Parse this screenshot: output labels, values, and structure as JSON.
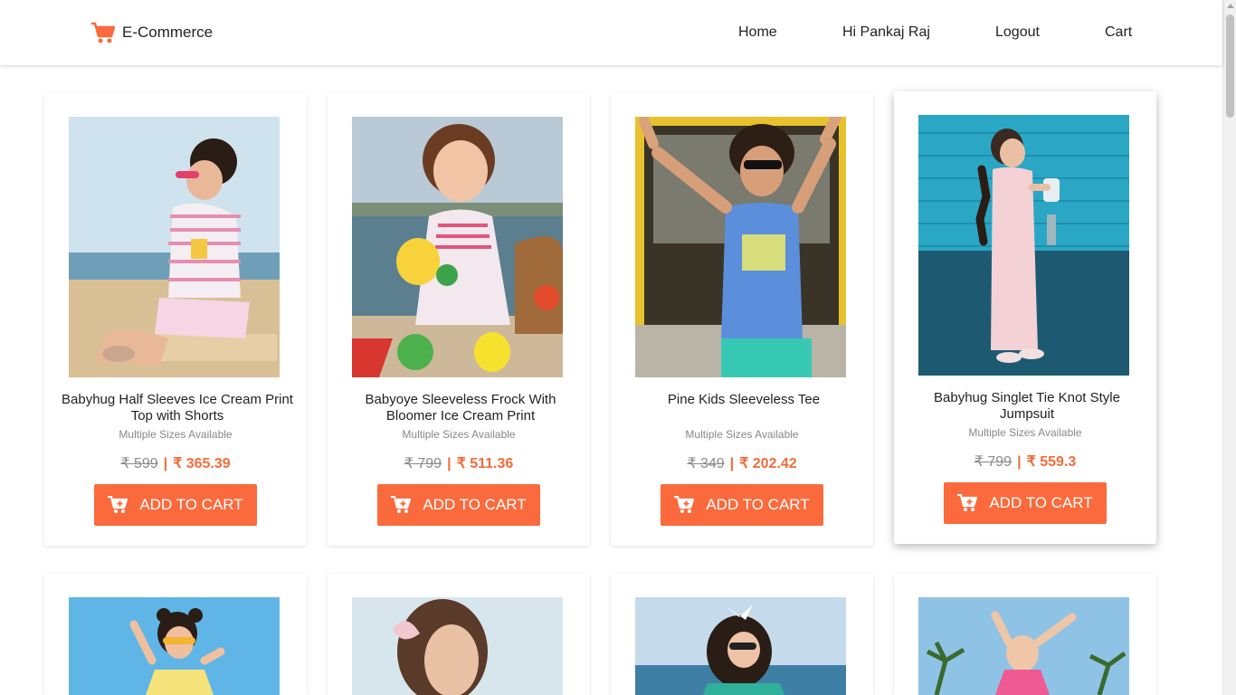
{
  "nav": {
    "brand": "E-Commerce",
    "links": [
      "Home",
      "Hi Pankaj Raj",
      "Logout",
      "Cart"
    ],
    "brand_icon": "shopping-cart-icon",
    "accent": "#fb6a3c"
  },
  "products": [
    {
      "title": "Babyhug Half Sleeves Ice Cream Print Top with Shorts",
      "sizes": "Multiple Sizes Available",
      "mrp": "₹ 599",
      "price": "₹ 365.39",
      "button": "ADD TO CART"
    },
    {
      "title": "Babyoye Sleeveless Frock With Bloomer Ice Cream Print",
      "sizes": "Multiple Sizes Available",
      "mrp": "₹ 799",
      "price": "₹ 511.36",
      "button": "ADD TO CART"
    },
    {
      "title": "Pine Kids Sleeveless Tee",
      "sizes": "Multiple Sizes Available",
      "mrp": "₹ 349",
      "price": "₹ 202.42",
      "button": "ADD TO CART"
    },
    {
      "title": "Babyhug Singlet Tie Knot Style Jumpsuit",
      "sizes": "Multiple Sizes Available",
      "mrp": "₹ 799",
      "price": "₹ 559.3",
      "button": "ADD TO CART"
    }
  ],
  "colors": {
    "sale_price": "#f26b3a",
    "mrp": "#8a8a8a"
  }
}
